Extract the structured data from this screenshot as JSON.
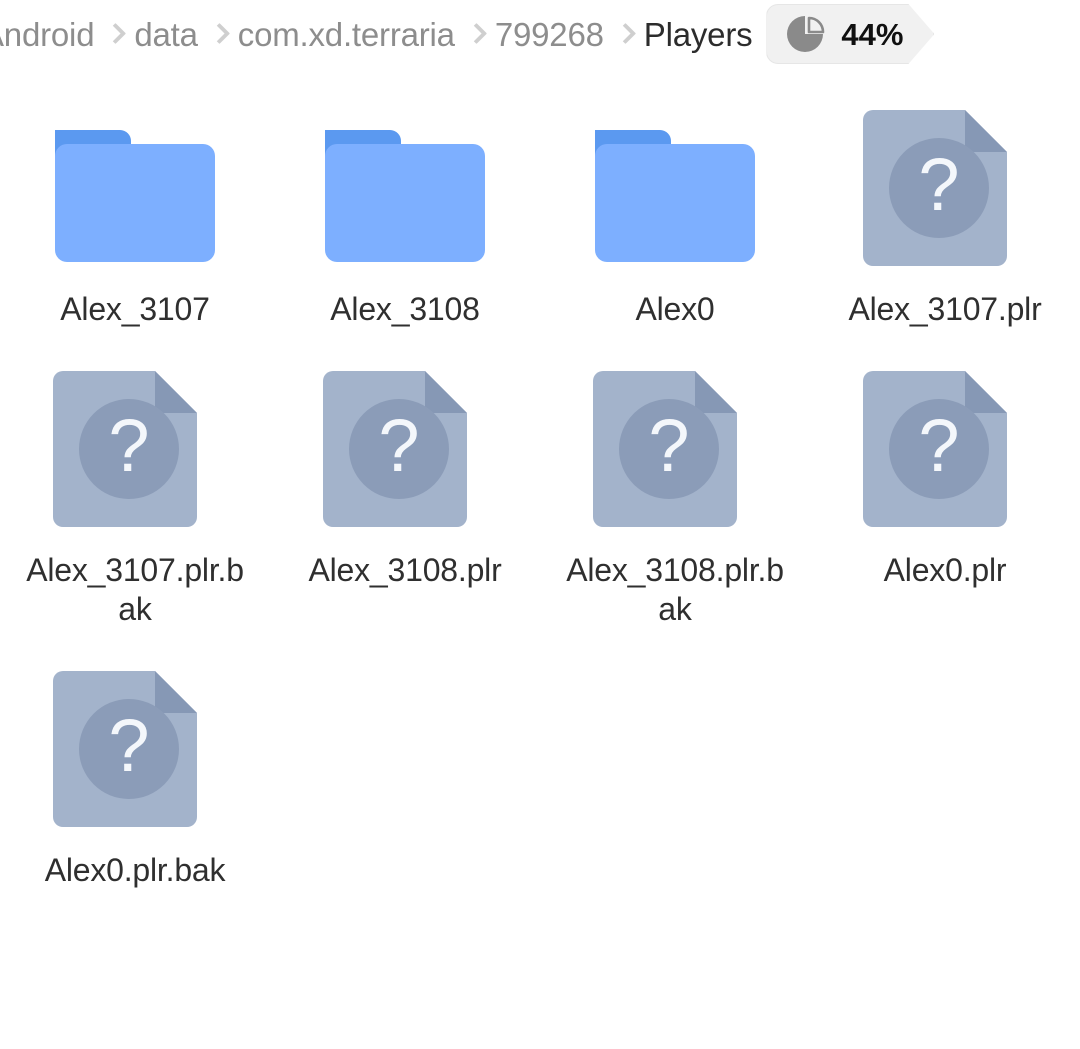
{
  "breadcrumb": {
    "segments": [
      {
        "label": "Android",
        "current": false
      },
      {
        "label": "data",
        "current": false
      },
      {
        "label": "com.xd.terraria",
        "current": false
      },
      {
        "label": "799268",
        "current": false
      },
      {
        "label": "Players",
        "current": true
      }
    ],
    "storage_badge": {
      "icon": "pie-chart-icon",
      "value": "44%",
      "fill_percent": 44,
      "background_color": "#f1f1f1",
      "text_color": "#101010",
      "icon_color": "#8a8a8a"
    },
    "separator_icon": "chevron-right-icon",
    "text_color": "#8d8d8d",
    "current_text_color": "#2c2c2c",
    "separator_color": "#cfcfcf"
  },
  "colors": {
    "background": "#ffffff",
    "folder_body": "#7dafff",
    "folder_tab": "#5b99f0",
    "file_body": "#a3b3cb",
    "file_fold": "#8698b5",
    "file_circle": "#8b9cb8",
    "file_glyph": "#f4f7fb",
    "label_text": "#2f2f2f"
  },
  "files": [
    {
      "name": "Alex_3107",
      "type": "folder",
      "icon": "folder-icon"
    },
    {
      "name": "Alex_3108",
      "type": "folder",
      "icon": "folder-icon"
    },
    {
      "name": "Alex0",
      "type": "folder",
      "icon": "folder-icon"
    },
    {
      "name": "Alex_3107.plr",
      "type": "file",
      "icon": "unknown-file-icon"
    },
    {
      "name": "Alex_3107.plr.bak",
      "type": "file",
      "icon": "unknown-file-icon"
    },
    {
      "name": "Alex_3108.plr",
      "type": "file",
      "icon": "unknown-file-icon"
    },
    {
      "name": "Alex_3108.plr.bak",
      "type": "file",
      "icon": "unknown-file-icon"
    },
    {
      "name": "Alex0.plr",
      "type": "file",
      "icon": "unknown-file-icon"
    },
    {
      "name": "Alex0.plr.bak",
      "type": "file",
      "icon": "unknown-file-icon"
    }
  ]
}
